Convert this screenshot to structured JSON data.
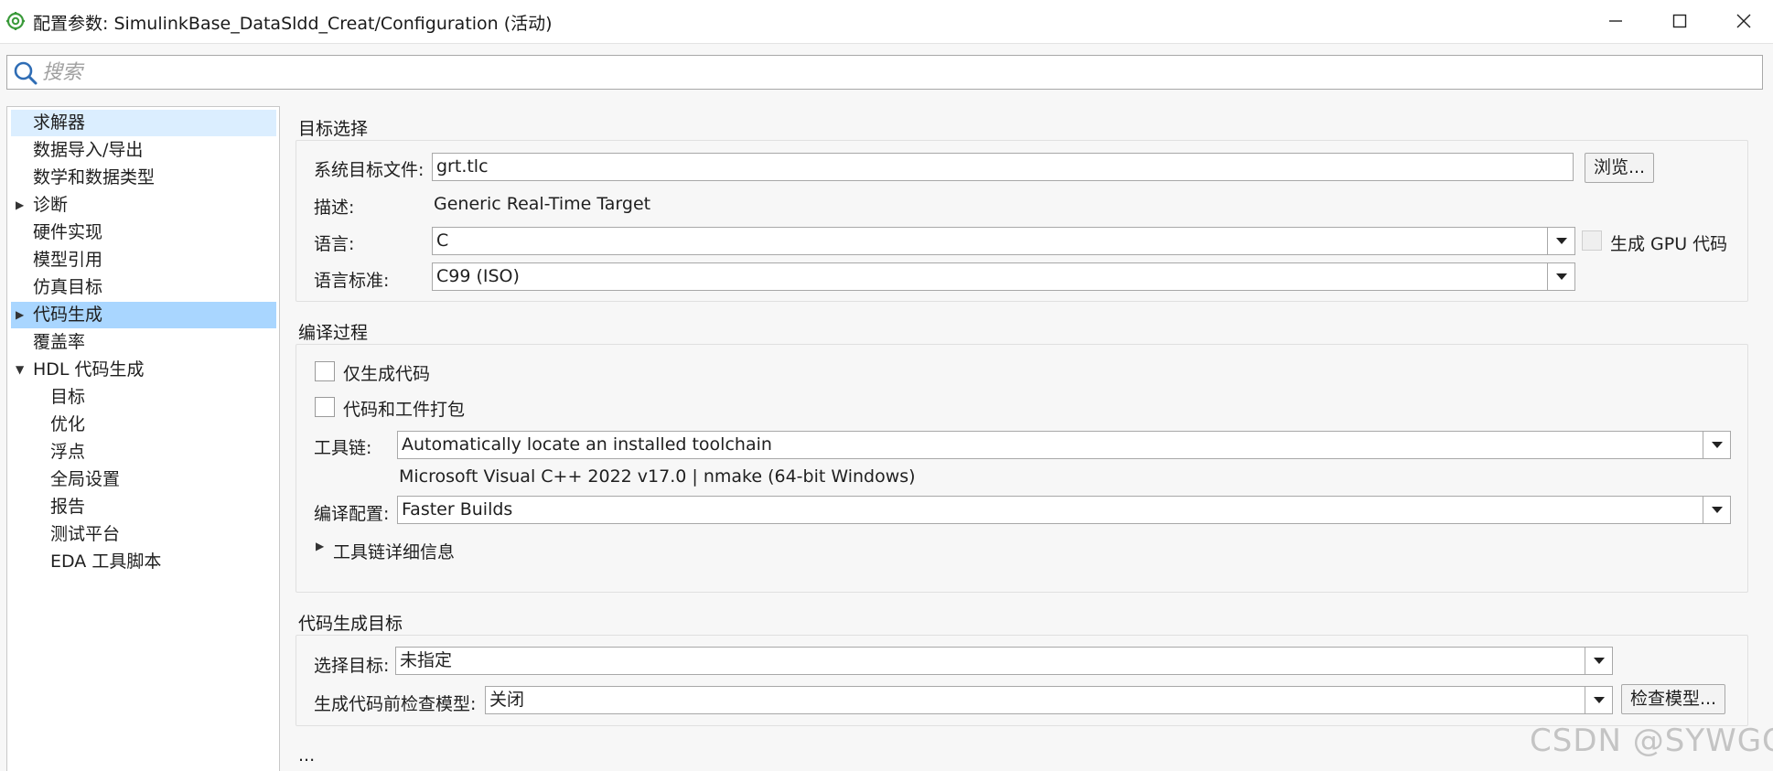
{
  "window": {
    "title": "配置参数: SimulinkBase_DataSldd_Creat/Configuration (活动)",
    "icons": [
      "app-gear-icon",
      "minimize-icon",
      "maximize-icon",
      "close-icon"
    ]
  },
  "search": {
    "placeholder": "搜索",
    "value": ""
  },
  "sidebar": {
    "items": [
      {
        "label": "求解器"
      },
      {
        "label": "数据导入/导出"
      },
      {
        "label": "数学和数据类型"
      },
      {
        "label": "诊断"
      },
      {
        "label": "硬件实现"
      },
      {
        "label": "模型引用"
      },
      {
        "label": "仿真目标"
      },
      {
        "label": "代码生成"
      },
      {
        "label": "覆盖率"
      },
      {
        "label": "HDL 代码生成"
      },
      {
        "label": "目标"
      },
      {
        "label": "优化"
      },
      {
        "label": "浮点"
      },
      {
        "label": "全局设置"
      },
      {
        "label": "报告"
      },
      {
        "label": "测试平台"
      },
      {
        "label": "EDA 工具脚本"
      }
    ]
  },
  "target": {
    "section_title": "目标选择",
    "system_target_label": "系统目标文件:",
    "system_target_value": "grt.tlc",
    "browse_label": "浏览...",
    "description_label": "描述:",
    "description_value": "Generic Real-Time Target",
    "language_label": "语言:",
    "language_value": "C",
    "gpu_label": "生成 GPU 代码",
    "standard_label": "语言标准:",
    "standard_value": "C99 (ISO)"
  },
  "build": {
    "section_title": "编译过程",
    "gen_only_label": "仅生成代码",
    "pack_label": "代码和工件打包",
    "toolchain_label": "工具链:",
    "toolchain_value": "Automatically locate an installed toolchain",
    "toolchain_info": "Microsoft Visual C++ 2022 v17.0 | nmake (64-bit Windows)",
    "config_label": "编译配置:",
    "config_value": "Faster Builds",
    "details_label": "工具链详细信息"
  },
  "codegen": {
    "section_title": "代码生成目标",
    "select_label": "选择目标:",
    "select_value": "未指定",
    "check_label": "生成代码前检查模型:",
    "check_value": "关闭",
    "check_button": "检查模型..."
  },
  "ellipsis": "...",
  "watermark": "CSDN @SYWGO"
}
